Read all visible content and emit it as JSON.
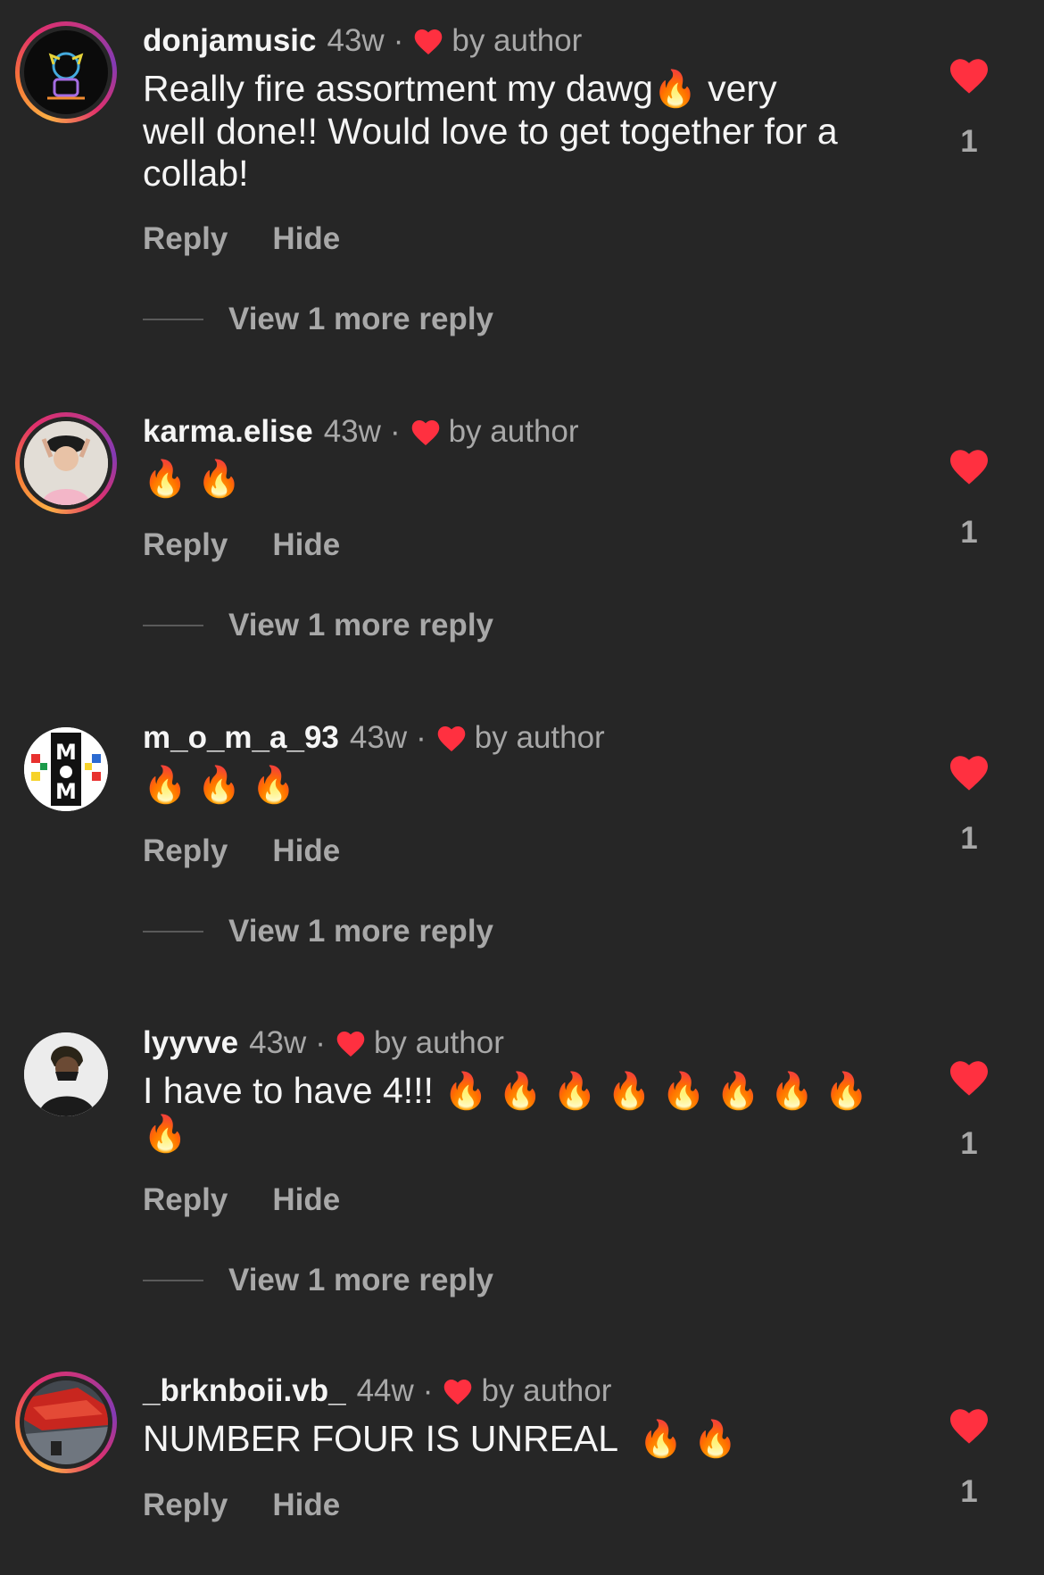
{
  "labels": {
    "by_author": "by author",
    "reply": "Reply",
    "hide": "Hide",
    "dot": "·"
  },
  "colors": {
    "heart": "#ff3040",
    "background": "#262626"
  },
  "comments": [
    {
      "username": "donjamusic",
      "time": "43w",
      "text_line1": "Really fire assortment my dawg",
      "text_line1_emoji": "🔥",
      "text_line1_end": " very",
      "text_rest": "well done!! Would love to get together for a collab!",
      "view_more": "View 1 more reply",
      "likes": "1"
    },
    {
      "username": "karma.elise",
      "time": "43w",
      "emojis": "🔥 🔥",
      "view_more": "View 1 more reply",
      "likes": "1"
    },
    {
      "username": "m_o_m_a_93",
      "time": "43w",
      "emojis": "🔥 🔥 🔥",
      "view_more": "View 1 more reply",
      "likes": "1"
    },
    {
      "username": "lyyvve",
      "time": "43w",
      "text": "I have to have 4!!!",
      "emojis_line1": "🔥 🔥 🔥 🔥 🔥 🔥 🔥 🔥",
      "emojis_line2": "🔥",
      "view_more": "View 1 more reply",
      "likes": "1"
    },
    {
      "username": "_brknboii.vb_",
      "time": "44w",
      "text": "NUMBER FOUR IS UNREAL",
      "emojis": "🔥 🔥",
      "likes": "1"
    }
  ]
}
